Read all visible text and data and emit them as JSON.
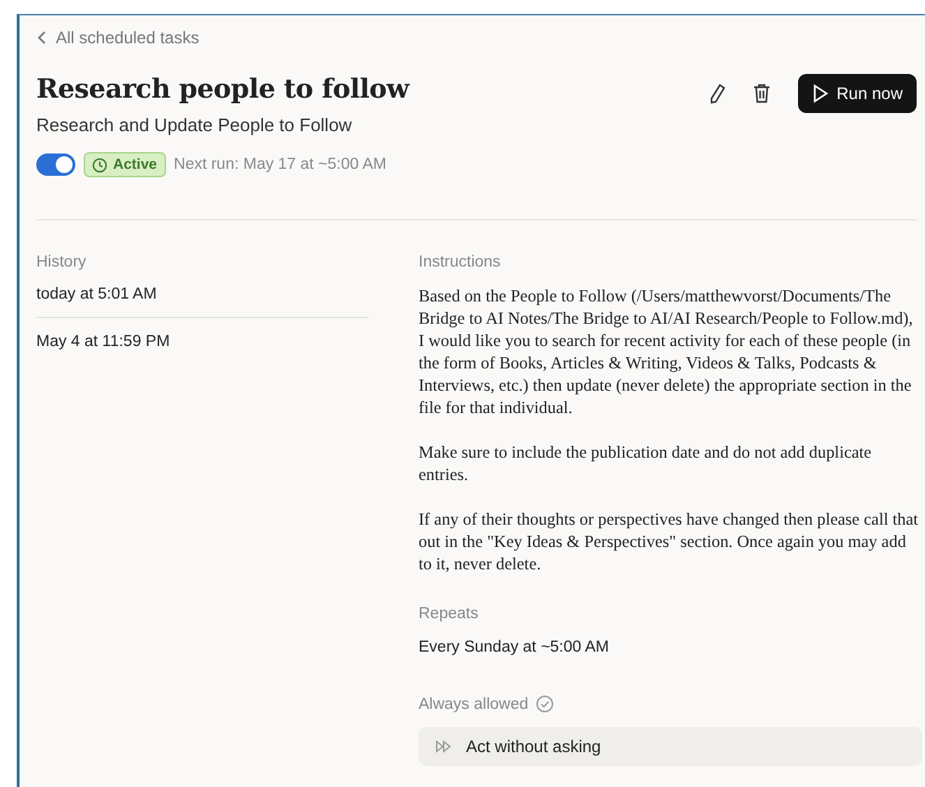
{
  "back_link": {
    "label": "All scheduled tasks"
  },
  "title": "Research people to follow",
  "subtitle": "Research and Update People to Follow",
  "status": {
    "enabled": true,
    "badge": "Active",
    "next_run": "Next run: May 17 at ~5:00 AM"
  },
  "actions": {
    "run_button": "Run now"
  },
  "history": {
    "heading": "History",
    "items": [
      {
        "label": "today at 5:01 AM"
      },
      {
        "label": "May 4 at 11:59 PM"
      }
    ]
  },
  "instructions": {
    "heading": "Instructions",
    "paragraphs": [
      "Based on the People to Follow (/Users/matthewvorst/Documents/The Bridge to AI Notes/The Bridge to AI/AI Research/People to Follow.md), I would like you to search for recent activity for each of these people (in the form of Books, Articles & Writing, Videos & Talks, Podcasts & Interviews, etc.) then update (never delete) the appropriate section in the file for that individual.",
      "Make sure to include the publication date and do not add duplicate entries.",
      "If any of their thoughts or perspectives have changed then please call that out in the \"Key Ideas & Perspectives\" section. Once again you may add to it, never delete."
    ]
  },
  "repeats": {
    "heading": "Repeats",
    "value": "Every Sunday at ~5:00 AM"
  },
  "always_allowed": {
    "heading": "Always allowed",
    "items": [
      {
        "label": "Act without asking"
      }
    ]
  }
}
